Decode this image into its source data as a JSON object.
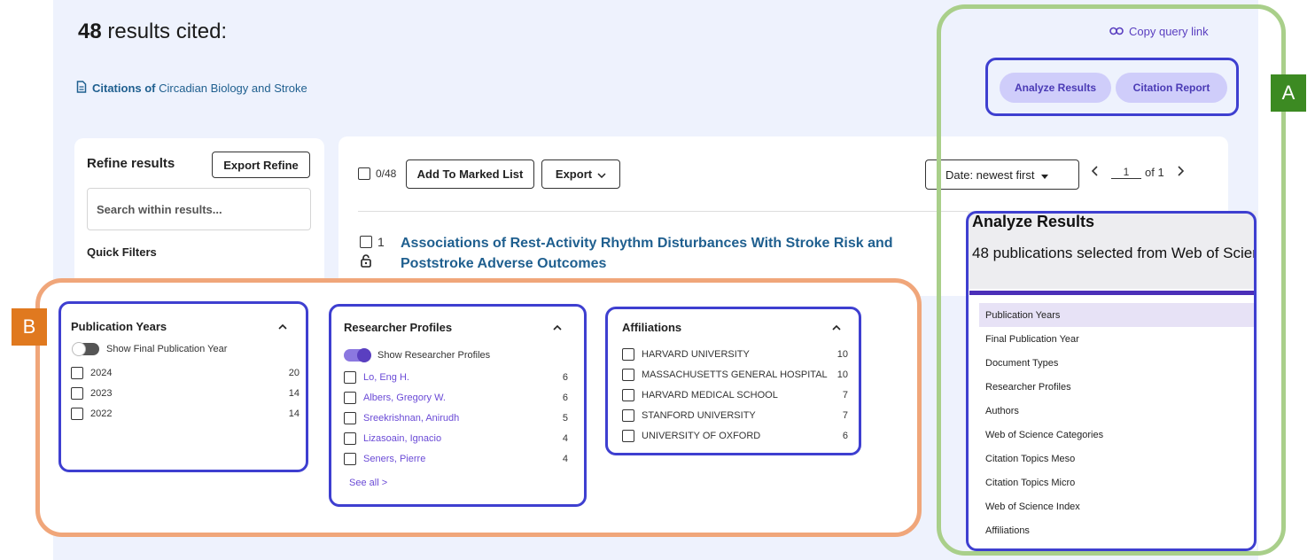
{
  "header": {
    "count": "48",
    "title_suffix": " results cited:",
    "citations_prefix": "Citations of",
    "citations_title": " Circadian Biology and Stroke",
    "copy_link": "Copy query link",
    "analyze_btn": "Analyze Results",
    "report_btn": "Citation Report"
  },
  "refine": {
    "title": "Refine results",
    "export_btn": "Export Refine",
    "search_placeholder": "Search within results...",
    "quick_filters": "Quick Filters"
  },
  "toolbar": {
    "selected": "0/48",
    "add_marked": "Add To Marked List",
    "export": "Export",
    "sort": "Date: newest first",
    "page": "1",
    "of_pages": "of 1"
  },
  "record": {
    "number": "1",
    "title": "Associations of Rest-Activity Rhythm Disturbances With Stroke Risk and Poststroke Adverse Outcomes"
  },
  "labels": {
    "a": "A",
    "b": "B"
  },
  "pub_years": {
    "title": "Publication Years",
    "toggle_label": "Show Final Publication Year",
    "items": [
      {
        "label": "2024",
        "count": "20"
      },
      {
        "label": "2023",
        "count": "14"
      },
      {
        "label": "2022",
        "count": "14"
      }
    ]
  },
  "researchers": {
    "title": "Researcher Profiles",
    "toggle_label": "Show Researcher Profiles",
    "items": [
      {
        "label": "Lo, Eng H.",
        "count": "6"
      },
      {
        "label": "Albers, Gregory W.",
        "count": "6"
      },
      {
        "label": "Sreekrishnan, Anirudh",
        "count": "5"
      },
      {
        "label": "Lizasoain, Ignacio",
        "count": "4"
      },
      {
        "label": "Seners, Pierre",
        "count": "4"
      }
    ],
    "see_all": "See all >"
  },
  "affiliations": {
    "title": "Affiliations",
    "items": [
      {
        "label": "HARVARD UNIVERSITY",
        "count": "10"
      },
      {
        "label": "MASSACHUSETTS GENERAL HOSPITAL",
        "count": "10"
      },
      {
        "label": "HARVARD MEDICAL SCHOOL",
        "count": "7"
      },
      {
        "label": "STANFORD UNIVERSITY",
        "count": "7"
      },
      {
        "label": "UNIVERSITY OF OXFORD",
        "count": "6"
      }
    ]
  },
  "analyze_panel": {
    "title": "Analyze Results",
    "sub_count": "48",
    "sub_text": " publications selected from Web of Science",
    "items": [
      "Publication Years",
      "Final Publication Year",
      "Document Types",
      "Researcher Profiles",
      "Authors",
      "Web of Science Categories",
      "Citation Topics Meso",
      "Citation Topics Micro",
      "Web of Science Index",
      "Affiliations"
    ]
  },
  "colors": {
    "accent_purple": "#5a3fc0",
    "pill_bg": "#cfcdfa",
    "annotation_green": "#a9cf8a",
    "annotation_orange": "#f0a67a",
    "badge_green": "#3c8a22",
    "badge_orange": "#e0791f",
    "frame_blue": "#3e3fd0"
  }
}
